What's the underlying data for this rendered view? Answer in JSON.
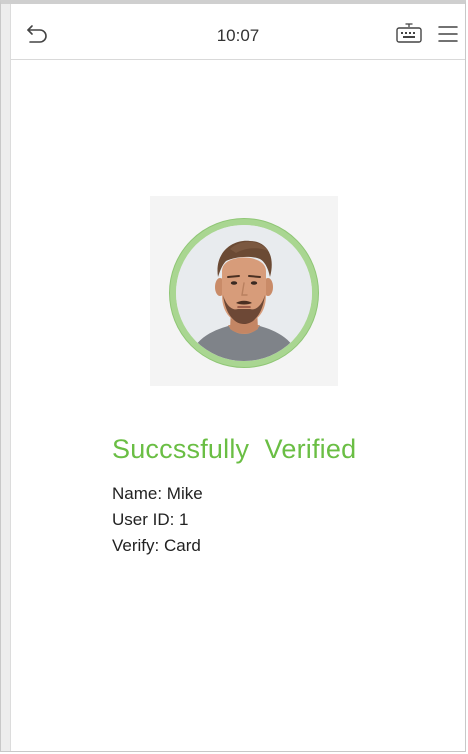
{
  "status_bar": {
    "time": "10:07"
  },
  "icons": {
    "back": "back-arrow-icon",
    "keyboard": "keyboard-icon",
    "menu": "menu-icon",
    "avatar": "user-photo"
  },
  "verification": {
    "title": "Succssfully  Verified",
    "name_line": "Name: Mike",
    "user_id_line": "User ID: 1",
    "verify_line": "Verify: Card"
  },
  "colors": {
    "success": "#6abe44",
    "ring": "#a9d691"
  }
}
